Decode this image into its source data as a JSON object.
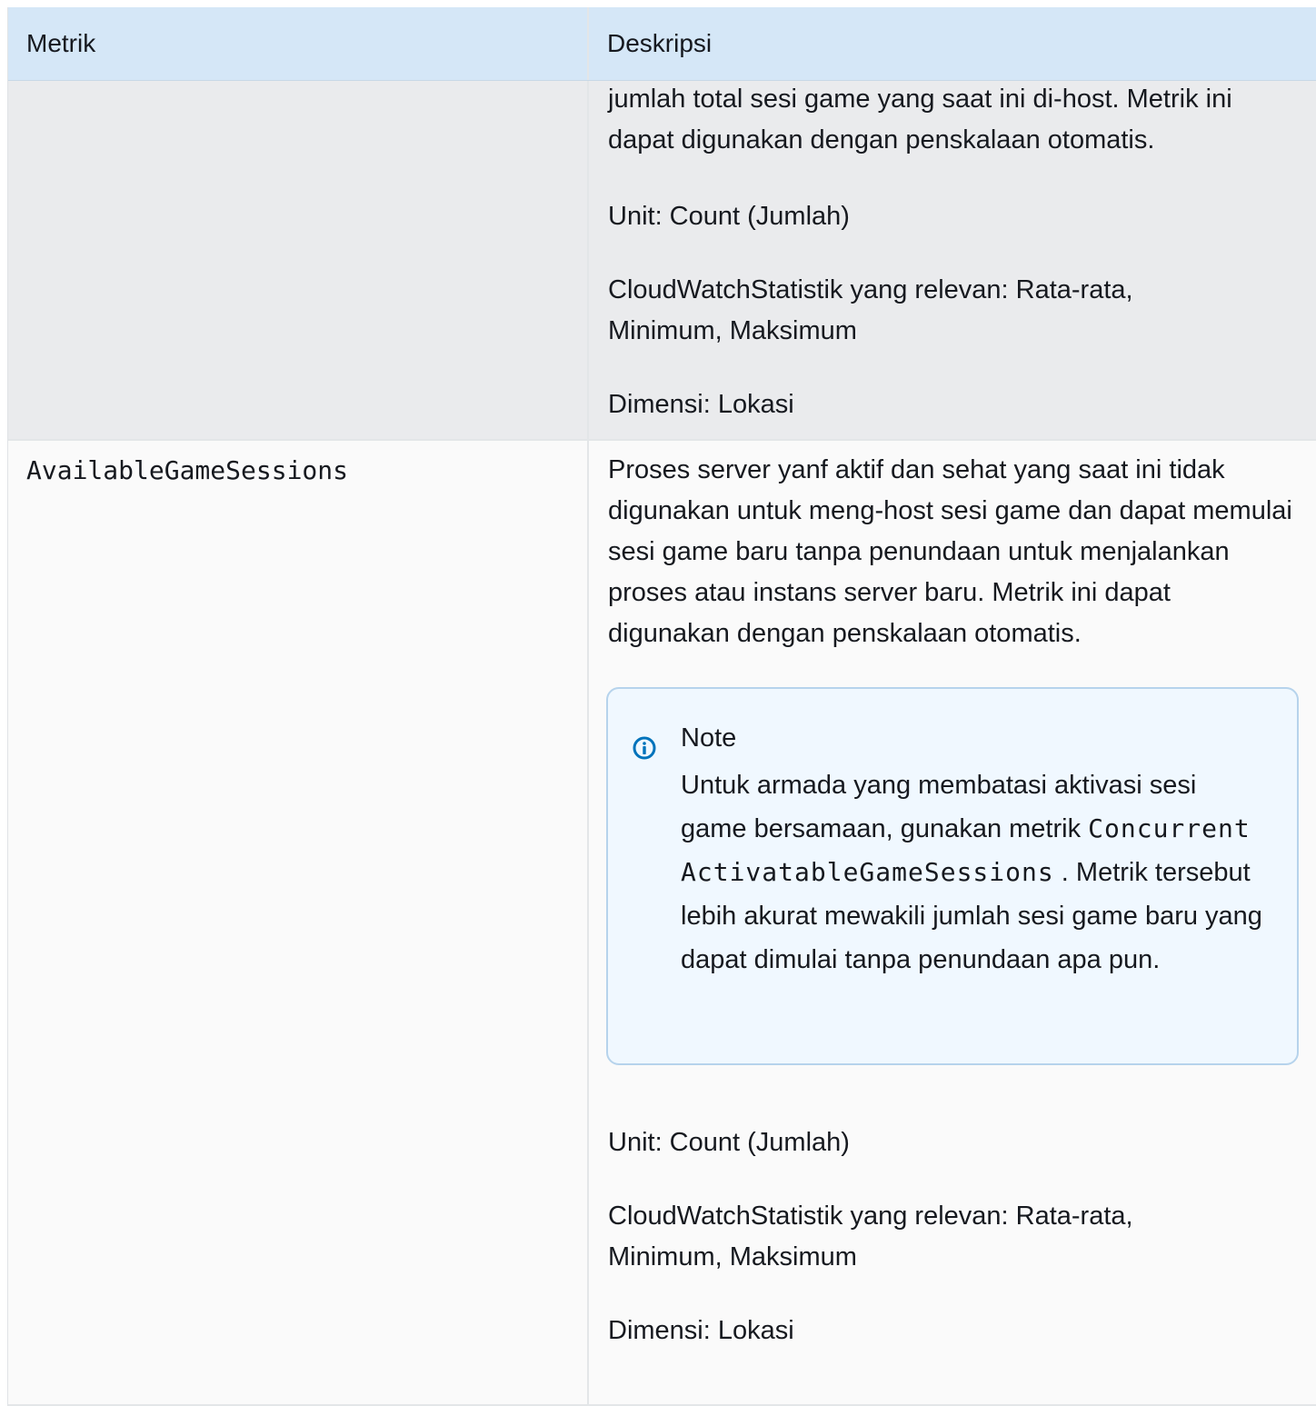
{
  "table": {
    "headers": {
      "metric": "Metrik",
      "description": "Deskripsi"
    },
    "rows": [
      {
        "metric": "",
        "description_paragraphs": [
          "jumlah total sesi game yang saat ini di-host. Metrik ini dapat digunakan dengan penskalaan otomatis.",
          "Unit: Count (Jumlah)",
          "CloudWatchStatistik yang relevan: Rata-rata, Minimum, Maksimum",
          "Dimensi: Lokasi"
        ]
      },
      {
        "metric": "AvailableGameSessions",
        "description_intro": "Proses server yanf aktif dan sehat yang saat ini tidak digunakan untuk meng-host sesi game dan dapat memulai sesi game baru tanpa penundaan untuk menjalankan proses atau instans server baru. Metrik ini dapat digunakan dengan penskalaan otomatis.",
        "note": {
          "icon": "info-icon",
          "title": "Note",
          "text_before": "Untuk armada yang membatasi aktivasi sesi game bersamaan, gunakan metrik",
          "code": "ConcurrentActivatableGameSessions",
          "text_after": ". Metrik tersebut lebih akurat mewakili jumlah sesi game baru yang dapat dimulai tanpa penundaan apa pun."
        },
        "description_paragraphs": [
          "Unit: Count (Jumlah)",
          "CloudWatchStatistik yang relevan: Rata-rata, Minimum, Maksimum",
          "Dimensi: Lokasi"
        ]
      }
    ]
  },
  "colors": {
    "header_bg": "#d5e7f7",
    "row1_bg": "#eaebed",
    "row2_bg": "#fafafa",
    "note_bg": "#f0f8ff",
    "note_border": "#b6d3ec",
    "info_icon": "#0073bb"
  }
}
